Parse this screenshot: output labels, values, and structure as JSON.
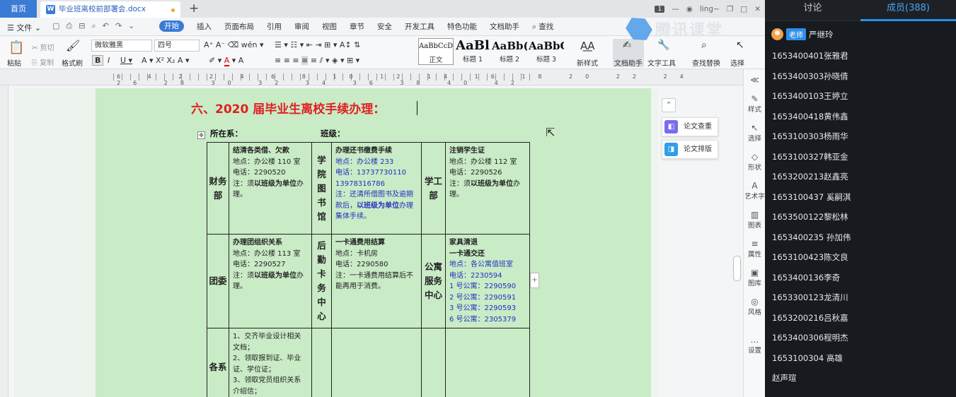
{
  "tabbar": {
    "home": "首页",
    "doc_title": "毕业班离校前部署会.docx",
    "new_tab": "+",
    "page_badge": "1",
    "user": "ling~"
  },
  "menubar": {
    "file": "文件",
    "items": [
      "开始",
      "插入",
      "页面布局",
      "引用",
      "审阅",
      "视图",
      "章节",
      "安全",
      "开发工具",
      "特色功能",
      "文档助手"
    ],
    "search": "查找"
  },
  "ribbon": {
    "paste": "粘贴",
    "cut": "剪切",
    "copy": "复制",
    "format_painter": "格式刷",
    "font_name": "微软雅黑",
    "font_size": "四号",
    "styles": [
      {
        "preview": "AaBbCcDd",
        "label": "正文"
      },
      {
        "preview": "AaBl",
        "label": "标题 1"
      },
      {
        "preview": "AaBb(",
        "label": "标题 2"
      },
      {
        "preview": "AaBbC",
        "label": "标题 3"
      }
    ],
    "new_style": "新样式",
    "doc_assistant": "文档助手",
    "text_tools": "文字工具",
    "find_replace": "查找替换",
    "select": "选择"
  },
  "ruler_numbers": "6 4 2 2 4 6 8 10 12 14 16 18 20 22 24 26 28 30 32 34 36 38 40 42",
  "document": {
    "heading": "六、2020 届毕业生离校手续办理：",
    "dept_label": "所在系：",
    "class_label": "班级：",
    "table": {
      "r1": {
        "c1_label": "财务部",
        "c1_title": "结清各类借、欠款",
        "c1_addr": "地点：办公楼 110 室",
        "c1_tel": "电话：2290520",
        "c1_note_a": "注：须",
        "c1_note_b": "以班级为单位",
        "c1_note_c": "办理。",
        "c2_label": "学院图书馆",
        "c2_title": "办理还书缴费手续",
        "c2_addr": "地点：办公楼 233",
        "c2_tel1": "电话：13737730110",
        "c2_tel2": "13978316786",
        "c2_note_a": "注：还清所借图书及逾期款后，",
        "c2_note_b": "以班级为单位",
        "c2_note_c": "办理集体手续。",
        "c3_label": "学工部",
        "c3_title": "注销学生证",
        "c3_addr": "地点：办公楼 112 室",
        "c3_tel": "电话：2290526",
        "c3_note_a": "注：须",
        "c3_note_b": "以班级为单位",
        "c3_note_c": "办理。"
      },
      "r2": {
        "c1_label": "团委",
        "c1_title": "办理团组织关系",
        "c1_addr": "地点：办公楼 113 室",
        "c1_tel": "电话：2290527",
        "c1_note_a": "注：须",
        "c1_note_b": "以班级为单位",
        "c1_note_c": "办理。",
        "c2_label": "后勤卡务中心",
        "c2_title": "一卡通费用结算",
        "c2_addr": "地点：卡机房",
        "c2_tel": "电话：2290580",
        "c2_note": "注：一卡通费用结算后不能再用于消费。",
        "c3_label": "公寓服务中心",
        "c3_title1": "家具清退",
        "c3_title2": "一卡通交还",
        "c3_addr": "地点：各公寓值班室",
        "c3_tel": "电话：2230594",
        "c3_apts": [
          "1 号公寓：2290590",
          "2 号公寓：2290591",
          "3 号公寓：2290593",
          "6 号公寓：2305379"
        ]
      },
      "r3": {
        "c1_label": "各系",
        "c1_items": [
          "1、交齐毕业设计相关文档；",
          "2、领取报到证、毕业证、学位证；",
          "3、领取党员组织关系介绍信；"
        ]
      }
    }
  },
  "float_panel": {
    "collapse": "⌃",
    "check": "论文查重",
    "layout": "论文排版"
  },
  "side_tools": [
    {
      "icon": "✎",
      "label": "样式"
    },
    {
      "icon": "↖",
      "label": "选择"
    },
    {
      "icon": "◇",
      "label": "形状"
    },
    {
      "icon": "A",
      "label": "艺术字"
    },
    {
      "icon": "▥",
      "label": "图表"
    },
    {
      "icon": "≡",
      "label": "属性"
    },
    {
      "icon": "▣",
      "label": "图库"
    },
    {
      "icon": "◎",
      "label": "风格"
    },
    {
      "icon": "…",
      "label": "设置"
    }
  ],
  "watermark": "腾讯课堂",
  "panel": {
    "tab_discuss": "讨论",
    "tab_members": "成员(388)",
    "teacher_role": "老师",
    "teacher_name": "严继玲",
    "members": [
      "1653400401张雅君",
      "1653400303孙晓倩",
      "1653400103王婷立",
      "1653400418黄伟鑫",
      "1653100303杨雨华",
      "1653100327韩亚金",
      "1653200213赵鑫亮",
      "1653100437 奚嗣淇",
      "1653500122黎松林",
      "1653400235 孙加伟",
      "1653100423陈文良",
      "1653400136李奇",
      "1653300123龙清川",
      "1653200216吕秋嘉",
      "1653400306程明杰",
      "1653100304 高雄",
      "赵声瑄"
    ]
  }
}
